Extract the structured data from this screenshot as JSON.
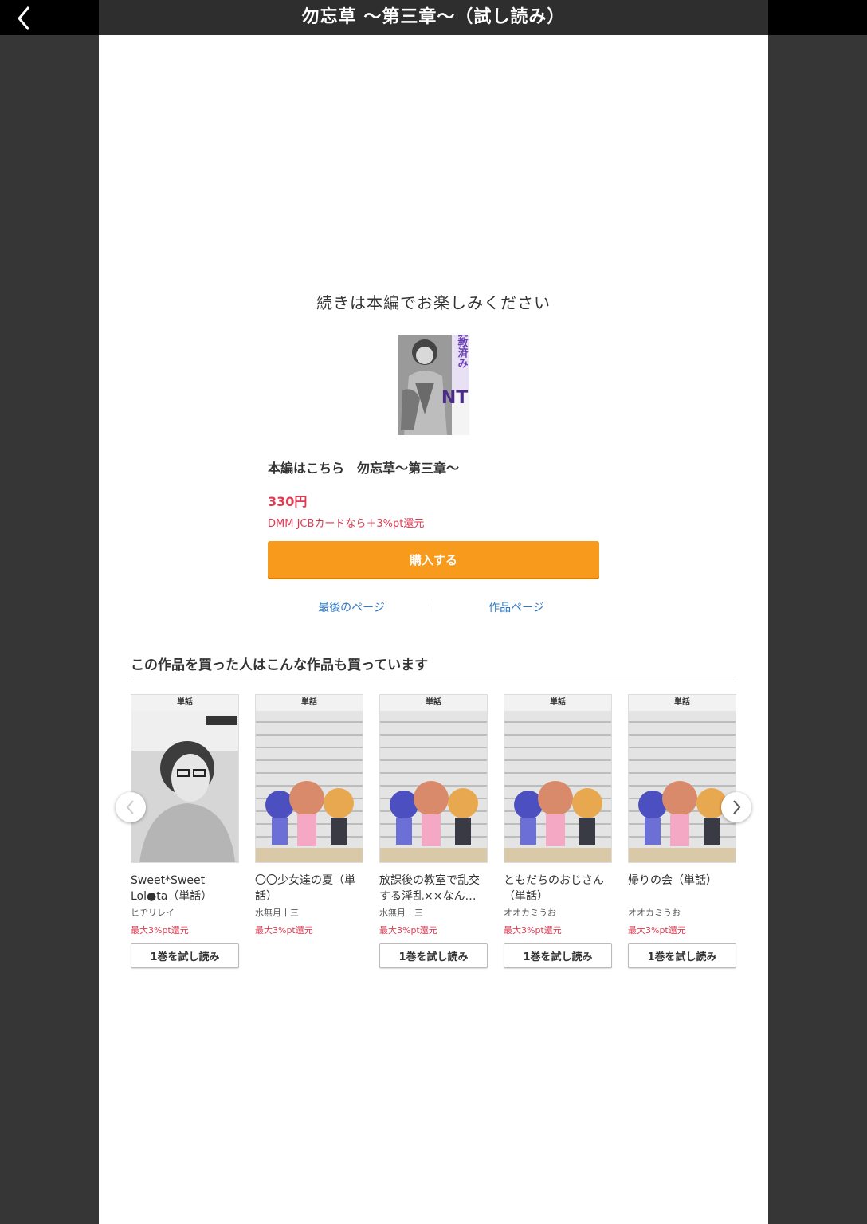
{
  "header": {
    "title": "勿忘草 〜第三章〜（試し読み）"
  },
  "end_screen": {
    "message": "続きは本編でお楽しみください",
    "cover_text": "NTR",
    "cover_vertical_text": "調教済み",
    "buy_title": "本編はこちら　勿忘草〜第三章〜",
    "price": "330円",
    "point_note": "DMM JCBカードなら＋3%pt還元",
    "buy_button": "購入する",
    "link_last_page": "最後のページ",
    "link_work_page": "作品ページ"
  },
  "recommendations": {
    "heading": "この作品を買った人はこんな作品も買っています",
    "items": [
      {
        "tag": "単話",
        "title": "Sweet*Sweet Lol●ta（単話）",
        "author": "ヒヂリレイ",
        "points": "最大3%pt還元",
        "trial_label": "1巻を試し読み"
      },
      {
        "tag": "単話",
        "title": "〇〇少女達の夏（単話）",
        "author": "水無月十三",
        "points": "最大3%pt還元",
        "trial_label": ""
      },
      {
        "tag": "単話",
        "title": "放課後の教室で乱交する淫乱××なん…",
        "author": "水無月十三",
        "points": "最大3%pt還元",
        "trial_label": "1巻を試し読み"
      },
      {
        "tag": "単話",
        "title": "ともだちのおじさん（単話）",
        "author": "オオカミうお",
        "points": "最大3%pt還元",
        "trial_label": "1巻を試し読み"
      },
      {
        "tag": "単話",
        "title": "帰りの会（単話）",
        "author": "オオカミうお",
        "points": "最大3%pt還元",
        "trial_label": "1巻を試し読み"
      }
    ]
  },
  "colors": {
    "accent_orange": "#f89a1c",
    "price_red": "#e03a52",
    "link_blue": "#2f78c4"
  }
}
